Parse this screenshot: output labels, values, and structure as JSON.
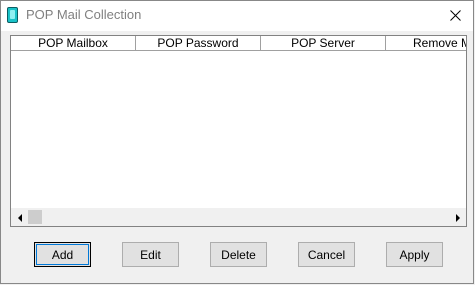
{
  "window": {
    "title": "POP Mail Collection",
    "icon": "app-icon",
    "close_icon": "close-icon"
  },
  "list": {
    "columns": [
      "POP Mailbox",
      "POP Password",
      "POP Server",
      "Remove Mail"
    ],
    "rows": []
  },
  "buttons": {
    "add": "Add",
    "edit": "Edit",
    "delete": "Delete",
    "cancel": "Cancel",
    "apply": "Apply"
  }
}
